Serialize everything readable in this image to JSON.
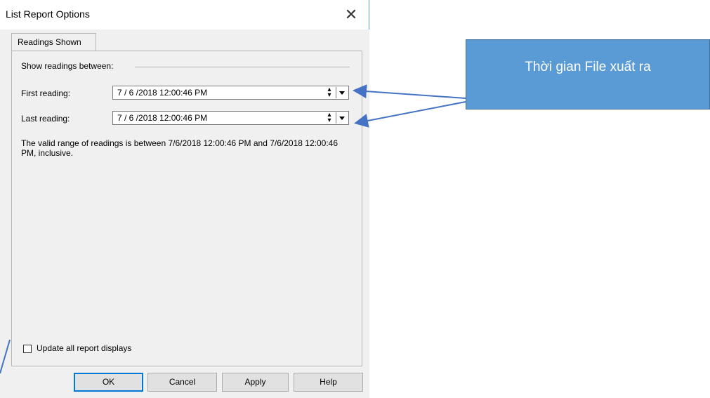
{
  "window": {
    "title": "List Report Options",
    "close_glyph": "✕"
  },
  "tabs": [
    {
      "label": "Readings Shown"
    }
  ],
  "readings": {
    "group_label": "Show readings between:",
    "first_label": "First reading:",
    "first_value": "7 / 6 /2018  12:00:46 PM",
    "last_label": "Last reading:",
    "last_value": "7 / 6 /2018  12:00:46 PM",
    "range_text": "The valid range of readings is between 7/6/2018 12:00:46 PM and 7/6/2018 12:00:46 PM, inclusive."
  },
  "options": {
    "update_all_label": "Update all report displays",
    "update_all_checked": false
  },
  "buttons": {
    "ok": "OK",
    "cancel": "Cancel",
    "apply": "Apply",
    "help": "Help"
  },
  "annotation": {
    "callout_text": "Thời gian File xuất ra",
    "callout_color": "#5b9bd5",
    "arrow_color": "#4472c4"
  }
}
